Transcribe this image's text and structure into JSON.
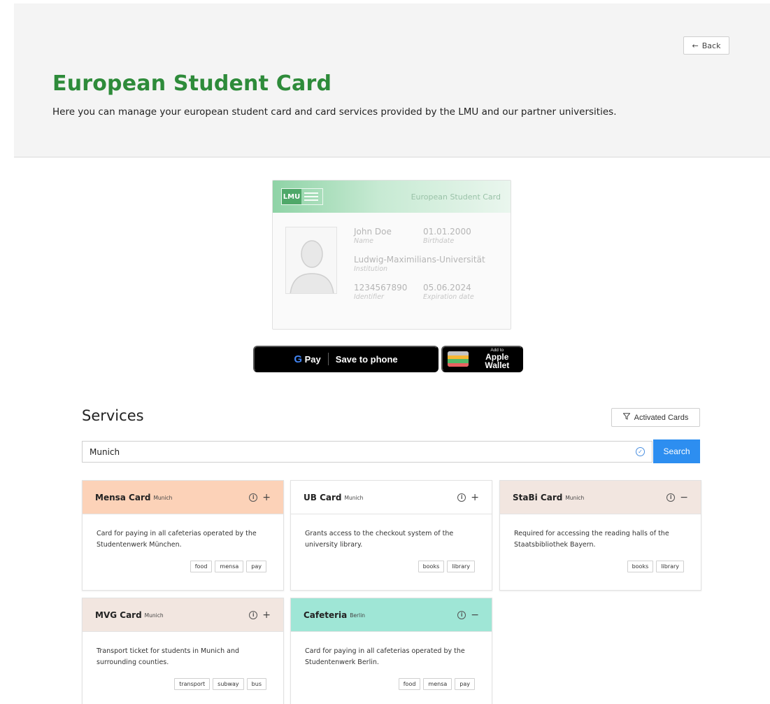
{
  "header": {
    "back_label": "Back",
    "title": "European Student Card",
    "subtitle": "Here you can manage your european student card and card services provided by the LMU and our partner universities."
  },
  "student_card": {
    "logo_text": "LMU",
    "card_label": "European Student Card",
    "name_value": "John Doe",
    "name_label": "Name",
    "birthdate_value": "01.01.2000",
    "birthdate_label": "Birthdate",
    "institution_value": "Ludwig-Maximilians-Universität",
    "institution_label": "Institution",
    "identifier_value": "1234567890",
    "identifier_label": "Identifier",
    "expiration_value": "05.06.2024",
    "expiration_label": "Expiration date"
  },
  "wallet": {
    "gpay_brand": "Pay",
    "gpay_label": "Save to phone",
    "apple_small": "Add to",
    "apple_big": "Apple Wallet"
  },
  "services": {
    "title": "Services",
    "filter_label": "Activated Cards",
    "search_value": "Munich",
    "search_button": "Search",
    "cards": [
      {
        "name": "Mensa Card",
        "city": "Munich",
        "toggle": "+",
        "header_color": "#fcd2b8",
        "description": "Card for paying in all cafeterias operated by the Studentenwerk München.",
        "tags": [
          "food",
          "mensa",
          "pay"
        ]
      },
      {
        "name": "UB Card",
        "city": "Munich",
        "toggle": "+",
        "header_color": "#ffffff",
        "description": "Grants access to the checkout system of the university library.",
        "tags": [
          "books",
          "library"
        ]
      },
      {
        "name": "StaBi Card",
        "city": "Munich",
        "toggle": "−",
        "header_color": "#f2e6e0",
        "description": "Required for accessing the reading halls of the Staatsbibliothek Bayern.",
        "tags": [
          "books",
          "library"
        ]
      },
      {
        "name": "MVG Card",
        "city": "Munich",
        "toggle": "+",
        "header_color": "#f2e6e0",
        "description": "Transport ticket for students in Munich and surrounding counties.",
        "tags": [
          "transport",
          "subway",
          "bus"
        ]
      },
      {
        "name": "Cafeteria",
        "city": "Berlin",
        "toggle": "−",
        "header_color": "#9fe6d6",
        "description": "Card for paying in all cafeterias operated by the Studentenwerk Berlin.",
        "tags": [
          "food",
          "mensa",
          "pay"
        ]
      }
    ]
  },
  "colors": {
    "title_green": "#2e8b3a",
    "search_blue": "#2d8ef0"
  }
}
